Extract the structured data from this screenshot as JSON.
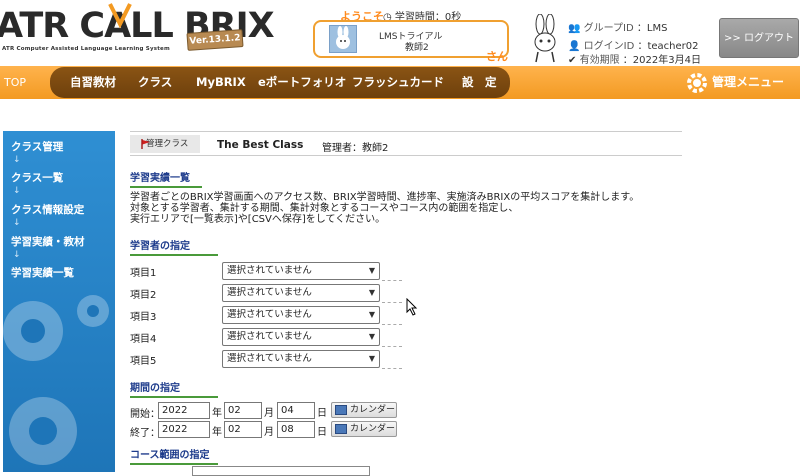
{
  "header": {
    "logo_title": "ATR CALL BRIX",
    "logo_subtitle": "ATR Computer Assisted Language Learning System",
    "version": "Ver.13.1.2",
    "welcome": "ようこそ",
    "study_time": "◷ 学習時間：0秒",
    "user_org": "LMSトライアル",
    "user_name": "教師2",
    "san": "さん",
    "group_label": "グループID",
    "group_value": "：LMS",
    "login_label": "ログインID",
    "login_value": "：teacher02",
    "expire_label": "有効期限",
    "expire_value": "：2022年3月4日",
    "logout": ">> ログアウト"
  },
  "nav": {
    "top": "TOP",
    "items": [
      "自習教材",
      "クラス",
      "MyBRIX",
      "eポートフォリオ",
      "フラッシュカード",
      "設　定"
    ],
    "admin": "管理メニュー"
  },
  "sidebar": {
    "items": [
      "クラス管理",
      "クラス一覧",
      "クラス情報設定",
      "学習実績・教材",
      "学習実績一覧"
    ],
    "arrow": "↓"
  },
  "breadcrumb": {
    "home": "管理クラス",
    "class_name": "The Best Class",
    "teacher": "管理者：教師2"
  },
  "section_title": "学習実績一覧",
  "description": [
    "学習者ごとのBRIX学習画面へのアクセス数、BRIX学習時間、進捗率、実施済みBRIXの平均スコアを集計します。",
    "対象とする学習者、集計する期間、集計対象とするコースやコース内の範囲を指定し、",
    "実行エリアで[一覧表示]や[CSVへ保存]をしてください。"
  ],
  "learner_section": "学習者の指定",
  "items": [
    {
      "label": "項目1",
      "value": "選択されていません"
    },
    {
      "label": "項目2",
      "value": "選択されていません"
    },
    {
      "label": "項目3",
      "value": "選択されていません"
    },
    {
      "label": "項目4",
      "value": "選択されていません"
    },
    {
      "label": "項目5",
      "value": "選択されていません"
    }
  ],
  "period_section": "期間の指定",
  "period": {
    "start": {
      "label": "開始：",
      "year": "2022",
      "month": "02",
      "day": "04"
    },
    "end": {
      "label": "終了：",
      "year": "2022",
      "month": "02",
      "day": "08"
    },
    "year_unit": "年",
    "month_unit": "月",
    "day_unit": "日",
    "calendar": "カレンダー"
  },
  "course_section": "コース範囲の指定",
  "colors": {
    "accent_orange": "#f39a22",
    "nav_brown": "#7a4a10",
    "sidebar_blue": "#2683c6",
    "title_blue": "#1e3c8c",
    "rule_green": "#4a9a3a"
  }
}
